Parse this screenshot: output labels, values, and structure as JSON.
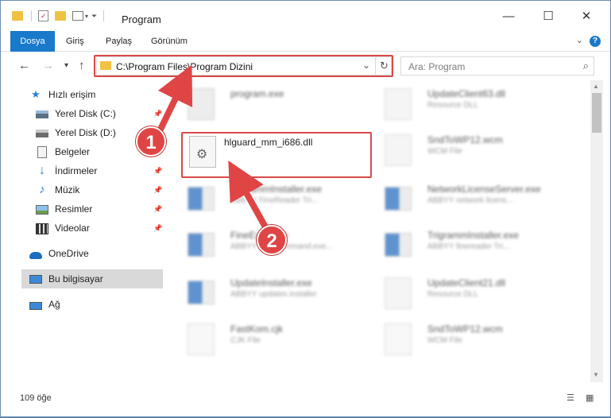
{
  "window": {
    "title": "Program",
    "minimize": "—",
    "maximize": "☐",
    "close": "✕"
  },
  "ribbon": {
    "tabs": [
      "Dosya",
      "Giriş",
      "Paylaş",
      "Görünüm"
    ]
  },
  "nav": {
    "back": "←",
    "forward": "→",
    "recent": "▾",
    "up": "↑",
    "address": "C:\\Program Files\\Program Dizini",
    "refresh": "↻",
    "search_placeholder": "Ara: Program"
  },
  "sidebar": {
    "quick_access": "Hızlı erişim",
    "items": [
      {
        "label": "Yerel Disk (C:)",
        "icon": "drive-icon"
      },
      {
        "label": "Yerel Disk (D:)",
        "icon": "drive-icon"
      },
      {
        "label": "Belgeler",
        "icon": "documents-icon"
      },
      {
        "label": "İndirmeler",
        "icon": "downloads-icon"
      },
      {
        "label": "Müzik",
        "icon": "music-icon"
      },
      {
        "label": "Resimler",
        "icon": "pictures-icon"
      },
      {
        "label": "Videolar",
        "icon": "videos-icon"
      }
    ],
    "onedrive": "OneDrive",
    "this_pc": "Bu bilgisayar",
    "network": "Ağ"
  },
  "files": [
    {
      "name": "program.exe",
      "desc": ""
    },
    {
      "name": "UpdateClient63.dll",
      "desc": "Resource DLL"
    },
    {
      "name": "hlguard_mm_i686.dll",
      "desc": ""
    },
    {
      "name": "SndToWP12.wcm",
      "desc": "WCM File"
    },
    {
      "name": "TrigrammInstaller.exe",
      "desc": "ABBYY FineReader Tri..."
    },
    {
      "name": "NetworkLicenseServer.exe",
      "desc": "ABBYY network licens..."
    },
    {
      "name": "FineExec.exe",
      "desc": "ABBYY FineCommand.exe..."
    },
    {
      "name": "TrigrammInstaller.exe",
      "desc": "ABBYY finereader Tri..."
    },
    {
      "name": "UpdateInstaller.exe",
      "desc": "ABBYY updates installer"
    },
    {
      "name": "UpdateClient21.dll",
      "desc": "Resource DLL"
    },
    {
      "name": "FastKom.cjk",
      "desc": "CJK File"
    },
    {
      "name": "SndToWP12.wcm",
      "desc": "WCM File"
    }
  ],
  "status": {
    "count": "109 öğe"
  },
  "annotations": {
    "badge1": "1",
    "badge2": "2"
  },
  "colors": {
    "accent": "#1979ca",
    "annotation": "#e04545"
  }
}
